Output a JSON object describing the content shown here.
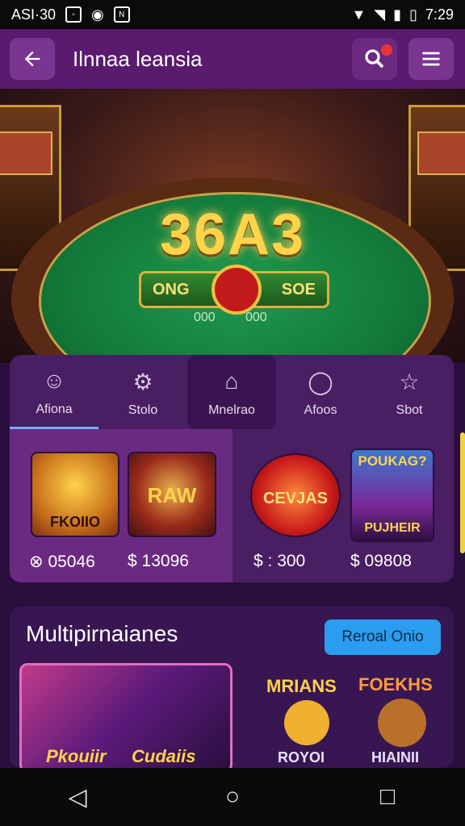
{
  "status_bar": {
    "left_text": "ASI·30",
    "time": "7:29"
  },
  "app_bar": {
    "title": "Ilnnaa leansia"
  },
  "hero": {
    "logo_number": "36A3",
    "logo_left": "ONG",
    "logo_right": "SOE",
    "felt_left": "000",
    "felt_right": "000"
  },
  "tabs": [
    {
      "label": "Afiona",
      "icon": "user-icon"
    },
    {
      "label": "Stolo",
      "icon": "gear-icon"
    },
    {
      "label": "Mnelrao",
      "icon": "house-icon"
    },
    {
      "label": "Afoos",
      "icon": "chat-icon"
    },
    {
      "label": "Sbot",
      "icon": "star-icon"
    }
  ],
  "games": [
    {
      "tile_text": "FKOIIO",
      "price": "05046",
      "price_prefix": "⊗"
    },
    {
      "tile_text": "RAW",
      "price": "13096",
      "price_prefix": "$"
    },
    {
      "tile_text": "CEVJAS",
      "price": "300",
      "price_prefix": "$ :"
    },
    {
      "tile_text": "PUJHEIR",
      "tile_top": "POUKAG?",
      "price": "09808",
      "price_prefix": "$"
    }
  ],
  "multiplayer": {
    "title": "Multipirnaianes",
    "button": "Reroal Onio",
    "tiles": [
      {
        "label": "Pkouiir"
      },
      {
        "label": "Cudaiis"
      },
      {
        "label": "ROYOI",
        "top": "MRIANS"
      },
      {
        "label": "HIAINII",
        "top": "FOEKHS"
      }
    ]
  }
}
